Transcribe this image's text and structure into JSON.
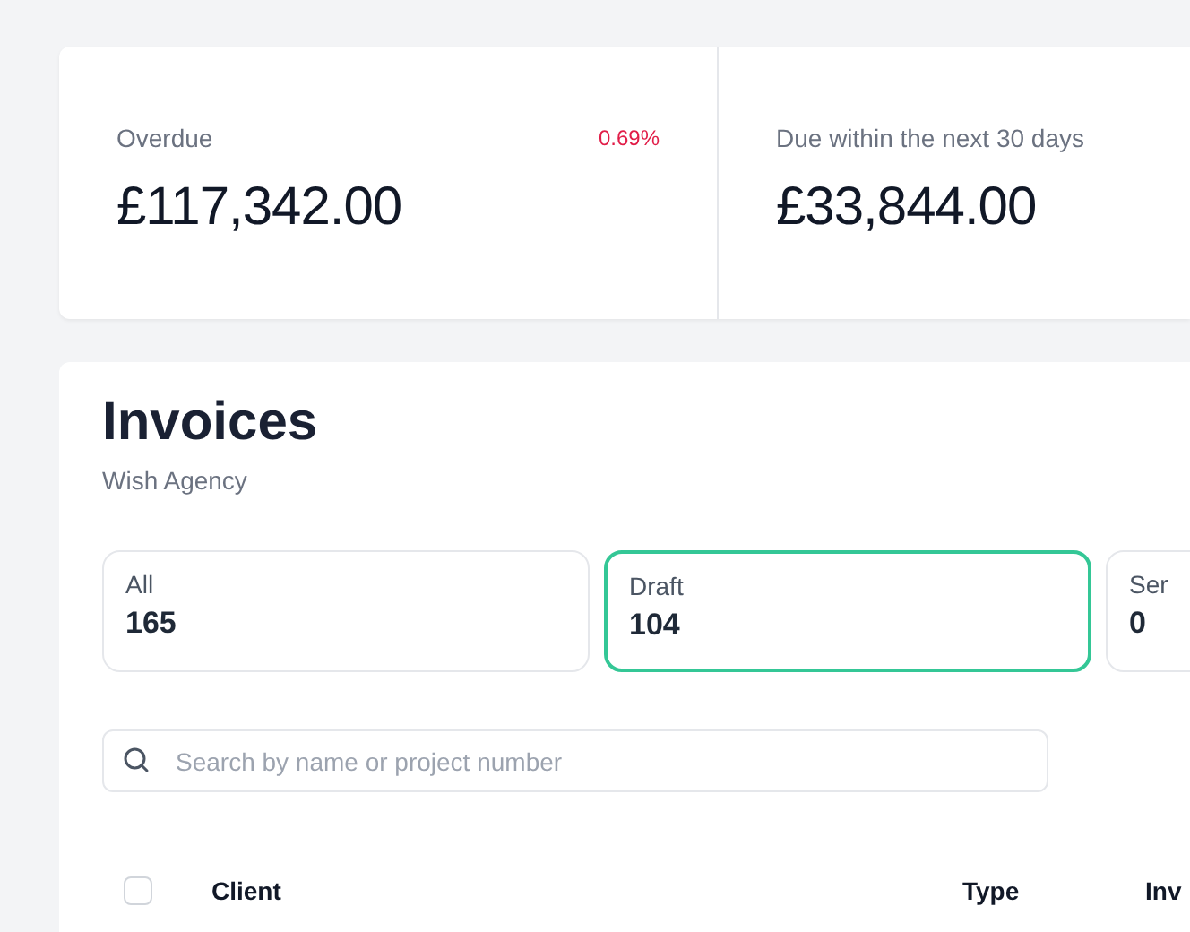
{
  "summary": [
    {
      "label": "Overdue",
      "amount": "£117,342.00",
      "change": "0.69%"
    },
    {
      "label": "Due within the next 30 days",
      "amount": "£33,844.00"
    }
  ],
  "invoices": {
    "title": "Invoices",
    "subtitle": "Wish Agency",
    "filters": [
      {
        "label": "All",
        "count": "165",
        "selected": false
      },
      {
        "label": "Draft",
        "count": "104",
        "selected": true
      },
      {
        "label": "Ser",
        "count": "0",
        "selected": false
      }
    ],
    "search": {
      "placeholder": "Search by name or project number"
    },
    "table": {
      "select_all": {
        "checked": false
      },
      "columns": [
        "Client",
        "Type",
        "Inv"
      ]
    }
  }
}
